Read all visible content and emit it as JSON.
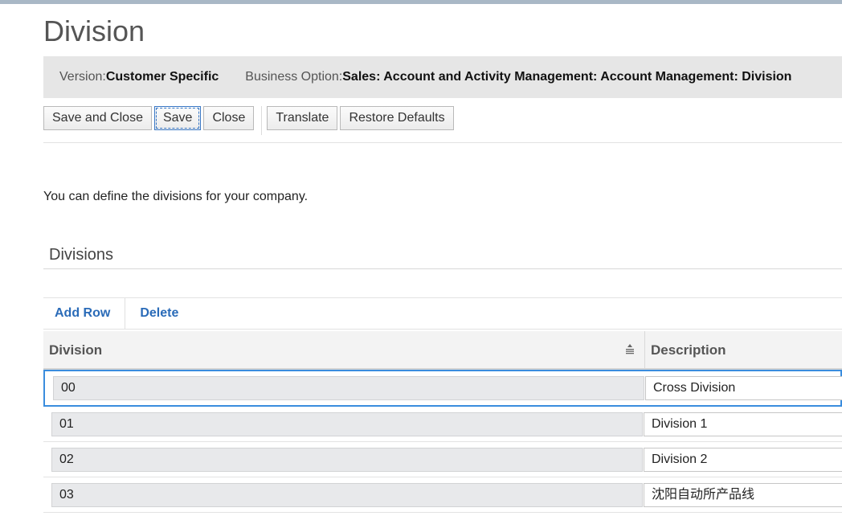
{
  "page": {
    "title": "Division"
  },
  "info": {
    "version_label": "Version:",
    "version_value": "Customer Specific",
    "business_option_label": "Business Option:",
    "business_option_value": "Sales: Account and Activity Management: Account Management: Division"
  },
  "toolbar": {
    "save_and_close": "Save and Close",
    "save": "Save",
    "close": "Close",
    "translate": "Translate",
    "restore_defaults": "Restore Defaults"
  },
  "intro_text": "You can define the divisions for your company.",
  "section": {
    "title": "Divisions"
  },
  "actions": {
    "add_row": "Add Row",
    "delete": "Delete"
  },
  "table": {
    "columns": {
      "division": "Division",
      "description": "Description"
    },
    "rows": [
      {
        "division": "00",
        "description": "Cross Division",
        "selected": true
      },
      {
        "division": "01",
        "description": "Division 1",
        "selected": false
      },
      {
        "division": "02",
        "description": "Division 2",
        "selected": false
      },
      {
        "division": "03",
        "description": "沈阳自动所产品线",
        "selected": false
      }
    ]
  },
  "colors": {
    "accent": "#2a6bb8",
    "selection_border": "#3a8dde"
  },
  "icons": {
    "sort": "sort-ascending-icon"
  }
}
